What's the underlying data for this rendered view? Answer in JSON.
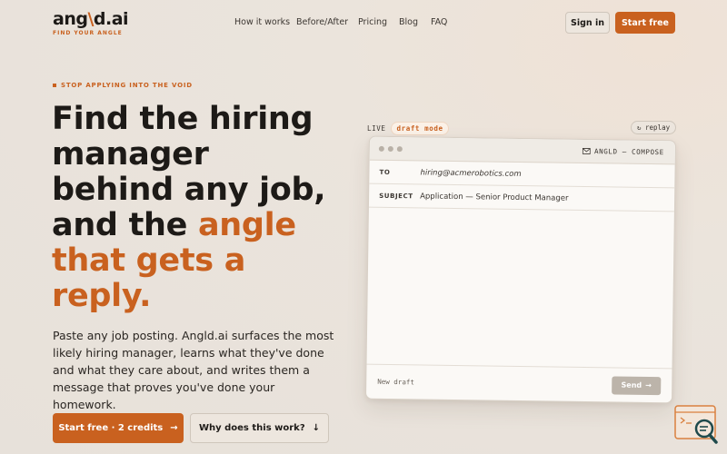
{
  "header": {
    "logo": {
      "text_a": "ang",
      "text_sep": "\\",
      "text_b": "d.ai",
      "tagline": "FIND YOUR ANGLE"
    },
    "nav": [
      "How it works",
      "Before/After",
      "Pricing",
      "Blog",
      "FAQ"
    ],
    "signin_label": "Sign in",
    "start_label": "Start free"
  },
  "hero": {
    "eyebrow": "STOP APPLYING INTO THE VOID",
    "headline_plain_1": "Find the hiring",
    "headline_plain_2": "manager",
    "headline_plain_3": "behind any job,",
    "headline_plain_4": "and the ",
    "headline_accent_1": "angle",
    "headline_accent_2": "that gets a",
    "headline_accent_3": "reply.",
    "subtext": "Paste any job posting. Angld.ai surfaces the most likely hiring manager, learns what they've done and what they care about, and writes them a message that proves you've done your homework.",
    "cta_primary": "Start free · 2 credits",
    "cta_primary_arrow": "→",
    "cta_secondary": "Why does this work?",
    "cta_secondary_arrow": "↓"
  },
  "compose": {
    "live_label": "LIVE",
    "mode_pill": "draft mode",
    "replay_label": "↻ replay",
    "window_title": "ANGLD — COMPOSE",
    "to_label": "TO",
    "to_value": "hiring@acmerobotics.com",
    "subject_label": "SUBJECT",
    "subject_value": "Application — Senior Product Manager",
    "footer_left": "New draft",
    "send_label": "Send",
    "send_arrow": "→"
  },
  "colors": {
    "accent": "#c9611f",
    "text": "#1d1a17",
    "background": "#e9e3dc"
  }
}
